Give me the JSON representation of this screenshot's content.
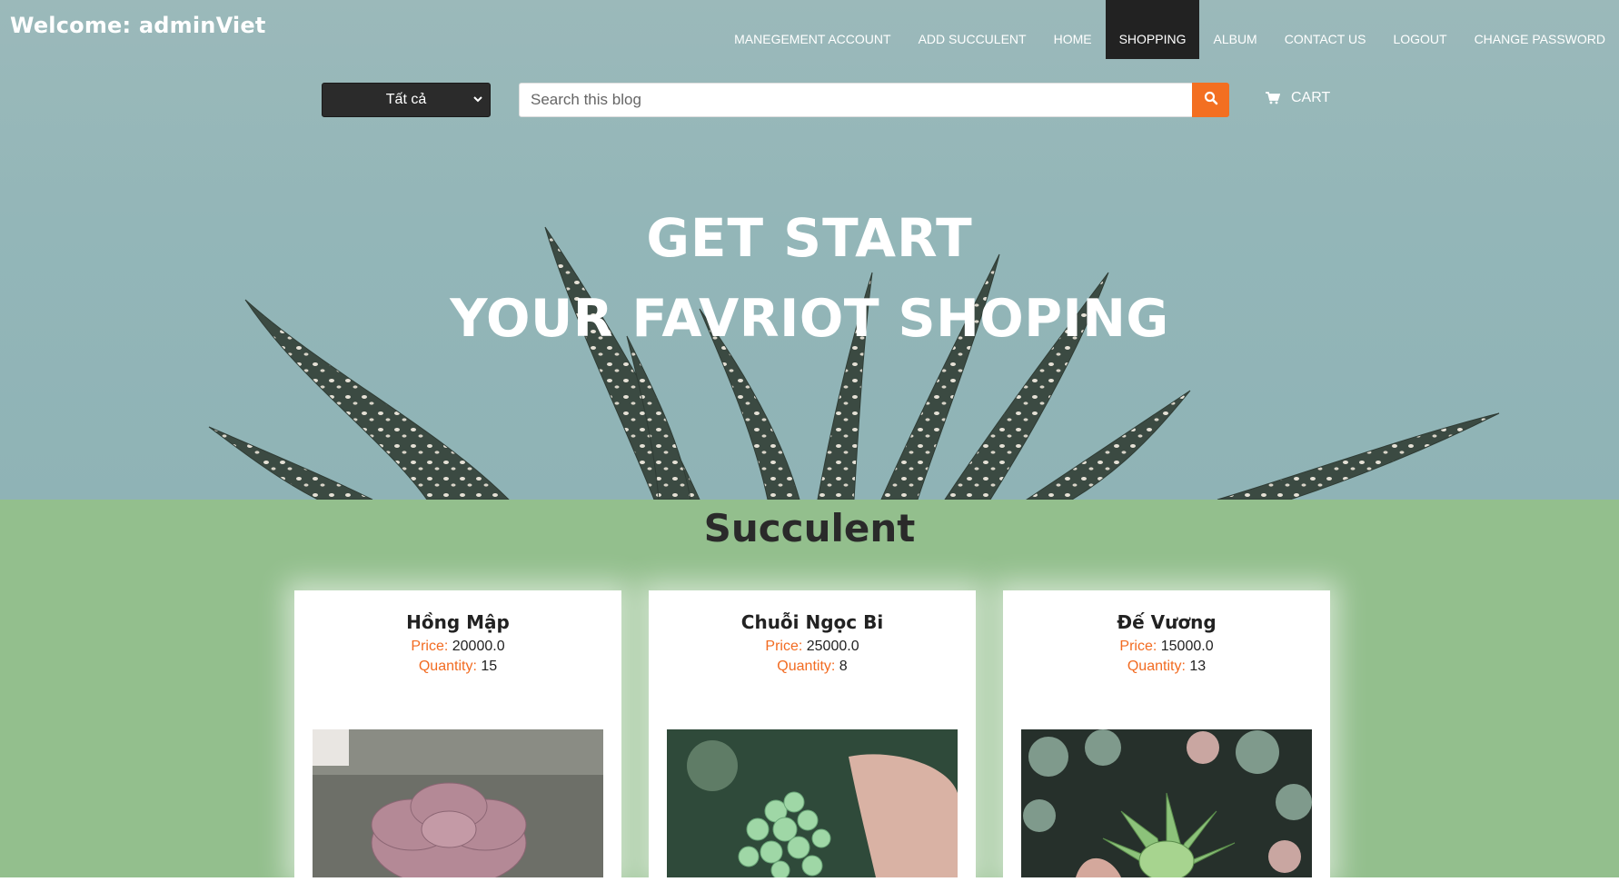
{
  "header": {
    "welcome": "Welcome: adminViet",
    "nav": [
      {
        "label": "MANEGEMENT ACCOUNT",
        "active": false
      },
      {
        "label": "ADD SUCCULENT",
        "active": false
      },
      {
        "label": "HOME",
        "active": false
      },
      {
        "label": "SHOPPING",
        "active": true
      },
      {
        "label": "ALBUM",
        "active": false
      },
      {
        "label": "CONTACT US",
        "active": false
      },
      {
        "label": "LOGOUT",
        "active": false
      },
      {
        "label": "CHANGE PASSWORD",
        "active": false
      }
    ]
  },
  "toolbar": {
    "category_selected": "Tất cả",
    "search_placeholder": "Search this blog",
    "cart_label": "CART"
  },
  "hero": {
    "line1": "GET START",
    "line2": "YOUR FAVRIOT SHOPING"
  },
  "section": {
    "title": "Succulent"
  },
  "products": [
    {
      "name": "Hồng Mập",
      "price_label": "Price:",
      "price": "20000.0",
      "quantity_label": "Quantity:",
      "quantity": "15"
    },
    {
      "name": "Chuỗi Ngọc Bi",
      "price_label": "Price:",
      "price": "25000.0",
      "quantity_label": "Quantity:",
      "quantity": "8"
    },
    {
      "name": "Đế Vương",
      "price_label": "Price:",
      "price": "15000.0",
      "quantity_label": "Quantity:",
      "quantity": "13"
    }
  ],
  "colors": {
    "accent": "#f36f21",
    "nav_active_bg": "#222222",
    "content_bg": "#93bf8d",
    "hero_bg": "#96b7b8"
  },
  "icons": {
    "search": "search-icon",
    "cart": "cart-icon",
    "dropdown": "chevron-down-icon"
  }
}
